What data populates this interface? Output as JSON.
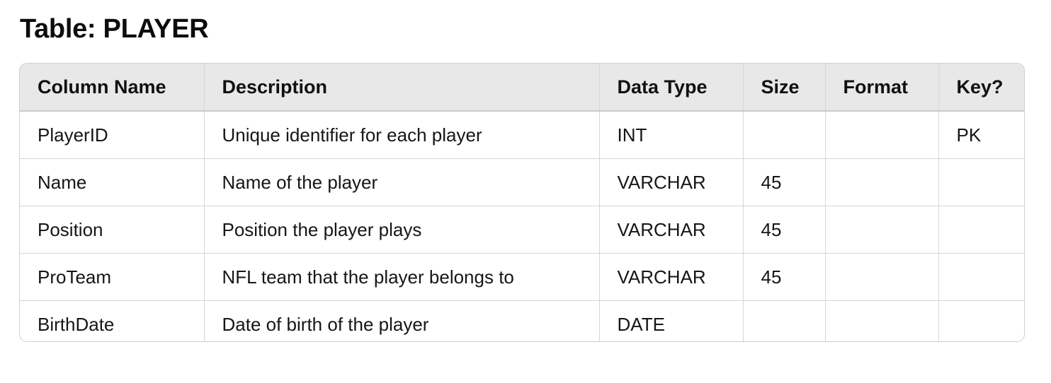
{
  "title": "Table: PLAYER",
  "table": {
    "headers": [
      "Column Name",
      "Description",
      "Data Type",
      "Size",
      "Format",
      "Key?"
    ],
    "rows": [
      [
        "PlayerID",
        "Unique identifier for each player",
        "INT",
        "",
        "",
        "PK"
      ],
      [
        "Name",
        "Name of the player",
        "VARCHAR",
        "45",
        "",
        ""
      ],
      [
        "Position",
        "Position the player plays",
        "VARCHAR",
        "45",
        "",
        ""
      ],
      [
        "ProTeam",
        "NFL team that the player belongs to",
        "VARCHAR",
        "45",
        "",
        ""
      ],
      [
        "BirthDate",
        "Date of birth of the player",
        "DATE",
        "",
        "",
        ""
      ]
    ]
  }
}
